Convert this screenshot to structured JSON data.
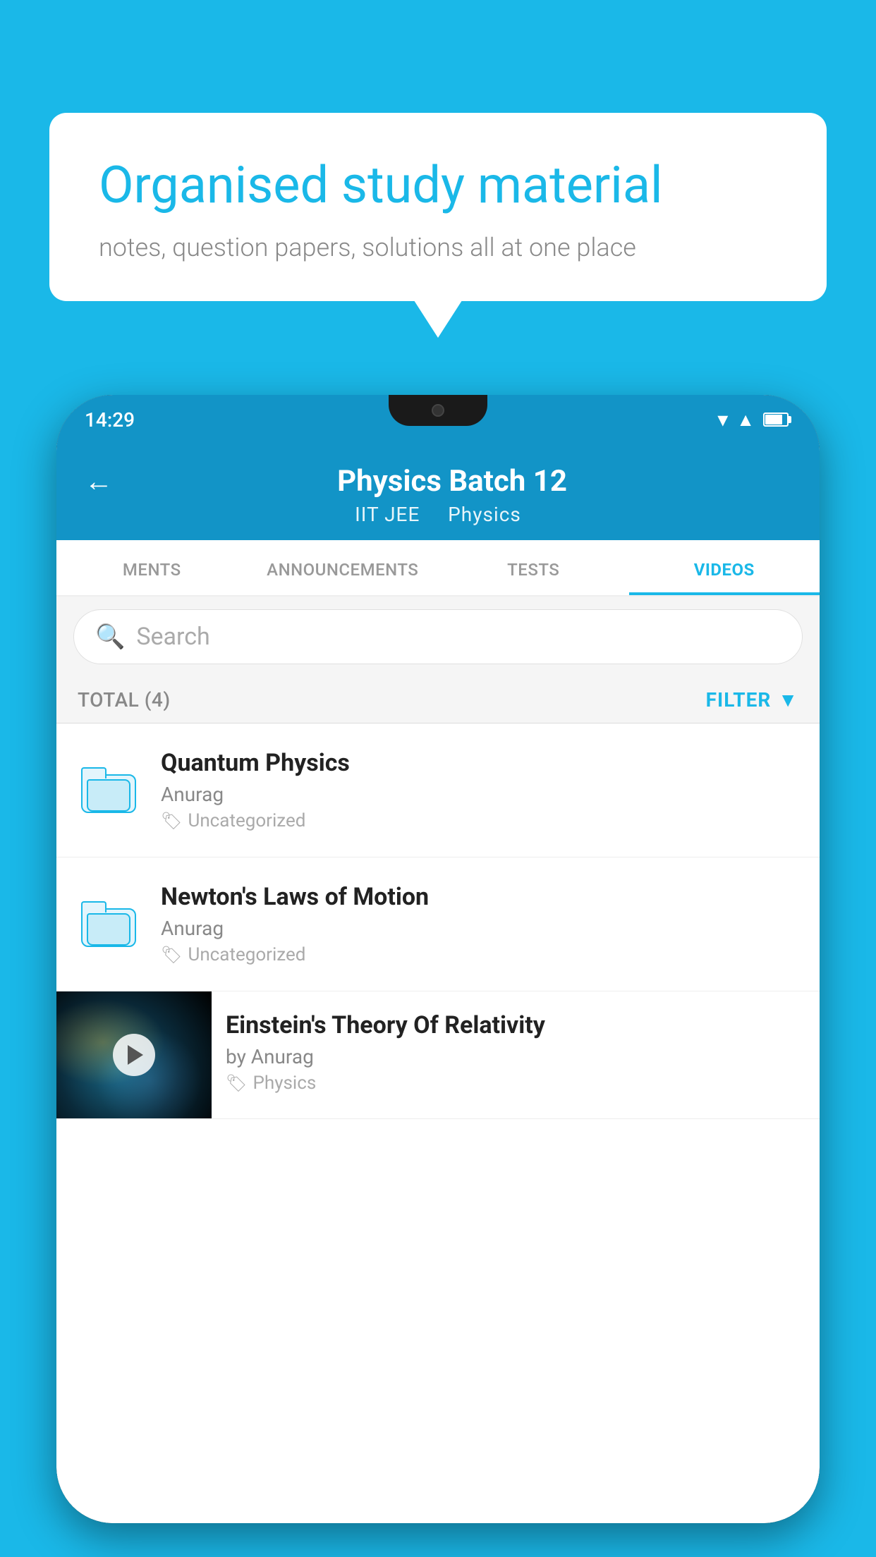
{
  "background": {
    "color": "#1ab8e8"
  },
  "speech_bubble": {
    "heading": "Organised study material",
    "subtext": "notes, question papers, solutions all at one place"
  },
  "phone": {
    "status_bar": {
      "time": "14:29"
    },
    "app_header": {
      "back_label": "←",
      "title": "Physics Batch 12",
      "subtitle_part1": "IIT JEE",
      "subtitle_part2": "Physics"
    },
    "tabs": [
      {
        "label": "MENTS",
        "active": false
      },
      {
        "label": "ANNOUNCEMENTS",
        "active": false
      },
      {
        "label": "TESTS",
        "active": false
      },
      {
        "label": "VIDEOS",
        "active": true
      }
    ],
    "search": {
      "placeholder": "Search"
    },
    "filter_row": {
      "total_label": "TOTAL (4)",
      "filter_label": "FILTER"
    },
    "list_items": [
      {
        "id": "quantum-physics",
        "title": "Quantum Physics",
        "author": "Anurag",
        "tag": "Uncategorized",
        "type": "folder"
      },
      {
        "id": "newtons-laws",
        "title": "Newton's Laws of Motion",
        "author": "Anurag",
        "tag": "Uncategorized",
        "type": "folder"
      },
      {
        "id": "einstein-relativity",
        "title": "Einstein's Theory Of Relativity",
        "author": "by Anurag",
        "tag": "Physics",
        "type": "video"
      }
    ]
  }
}
